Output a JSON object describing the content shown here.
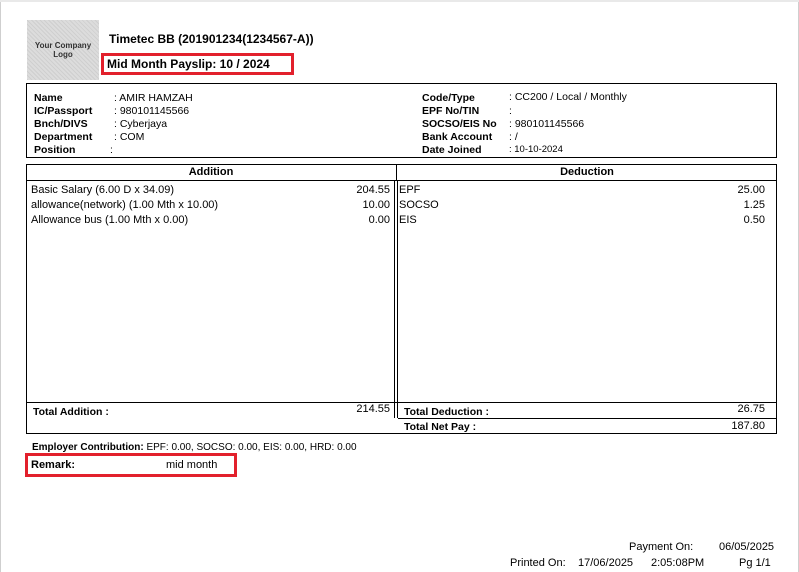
{
  "logo_text": "Your Company Logo",
  "company_name": "Timetec BB (201901234(1234567-A))",
  "payslip_title": "Mid Month Payslip: 10 / 2024",
  "employee": {
    "name_label": "Name",
    "name_value": ": AMIR HAMZAH",
    "ic_label": "IC/Passport",
    "ic_value": ": 980101145566",
    "branch_label": "Bnch/DIVS",
    "branch_value": ": Cyberjaya",
    "dept_label": "Department",
    "dept_value": ": COM",
    "position_label": "Position",
    "position_value": ":",
    "code_label": "Code/Type",
    "code_value": ": CC200 / Local / Monthly",
    "epf_label": "EPF No/TIN",
    "epf_value": ":",
    "socso_label": "SOCSO/EIS No",
    "socso_value": ": 980101145566",
    "bank_label": "Bank Account",
    "bank_value": ": /",
    "joined_label": "Date Joined",
    "joined_value": ": 10-10-2024"
  },
  "table": {
    "addition_header": "Addition",
    "deduction_header": "Deduction",
    "additions": [
      {
        "label": "Basic Salary (6.00 D x 34.09)",
        "amount": "204.55"
      },
      {
        "label": "allowance(network) (1.00 Mth x 10.00)",
        "amount": "10.00"
      },
      {
        "label": "Allowance bus (1.00 Mth x 0.00)",
        "amount": "0.00"
      }
    ],
    "deductions": [
      {
        "label": "EPF",
        "amount": "25.00"
      },
      {
        "label": "SOCSO",
        "amount": "1.25"
      },
      {
        "label": "EIS",
        "amount": "0.50"
      }
    ],
    "total_addition_label": "Total Addition :",
    "total_addition": "214.55",
    "total_deduction_label": "Total Deduction :",
    "total_deduction": "26.75",
    "net_pay_label": "Total Net Pay :",
    "net_pay": "187.80"
  },
  "employer_label": "Employer Contribution:",
  "employer_value": "EPF: 0.00, SOCSO: 0.00, EIS: 0.00, HRD: 0.00",
  "remark_label": "Remark:",
  "remark_value": "mid month",
  "footer": {
    "payment_label": "Payment On:",
    "payment_date": "06/05/2025",
    "printed_label": "Printed On:",
    "printed_date": "17/06/2025",
    "printed_time": "2:05:08PM",
    "page": "Pg 1/1"
  }
}
